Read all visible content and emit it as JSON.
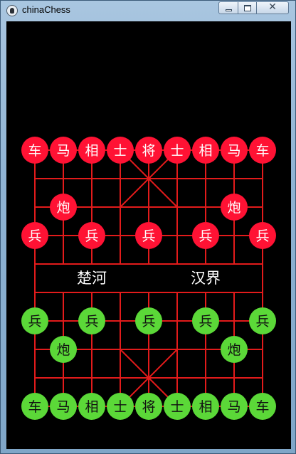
{
  "window": {
    "title": "chinaChess",
    "buttons": {
      "minimize": "",
      "maximize": "",
      "close": "✕"
    }
  },
  "board": {
    "files": 9,
    "ranks": 10,
    "line_color": "#e21b1b",
    "background": "#000000",
    "river": {
      "left_text": "楚河",
      "right_text": "汉界",
      "text_color": "#ffffff"
    }
  },
  "sides": {
    "red": {
      "fill": "#ff1234",
      "text": "#ffffff"
    },
    "green": {
      "fill": "#5bd838",
      "text": "#111111"
    }
  },
  "pieces": [
    {
      "side": "red",
      "label": "车",
      "file": 0,
      "rank": 0
    },
    {
      "side": "red",
      "label": "马",
      "file": 1,
      "rank": 0
    },
    {
      "side": "red",
      "label": "相",
      "file": 2,
      "rank": 0
    },
    {
      "side": "red",
      "label": "士",
      "file": 3,
      "rank": 0
    },
    {
      "side": "red",
      "label": "将",
      "file": 4,
      "rank": 0
    },
    {
      "side": "red",
      "label": "士",
      "file": 5,
      "rank": 0
    },
    {
      "side": "red",
      "label": "相",
      "file": 6,
      "rank": 0
    },
    {
      "side": "red",
      "label": "马",
      "file": 7,
      "rank": 0
    },
    {
      "side": "red",
      "label": "车",
      "file": 8,
      "rank": 0
    },
    {
      "side": "red",
      "label": "炮",
      "file": 1,
      "rank": 2
    },
    {
      "side": "red",
      "label": "炮",
      "file": 7,
      "rank": 2
    },
    {
      "side": "red",
      "label": "兵",
      "file": 0,
      "rank": 3
    },
    {
      "side": "red",
      "label": "兵",
      "file": 2,
      "rank": 3
    },
    {
      "side": "red",
      "label": "兵",
      "file": 4,
      "rank": 3
    },
    {
      "side": "red",
      "label": "兵",
      "file": 6,
      "rank": 3
    },
    {
      "side": "red",
      "label": "兵",
      "file": 8,
      "rank": 3
    },
    {
      "side": "green",
      "label": "兵",
      "file": 0,
      "rank": 6
    },
    {
      "side": "green",
      "label": "兵",
      "file": 2,
      "rank": 6
    },
    {
      "side": "green",
      "label": "兵",
      "file": 4,
      "rank": 6
    },
    {
      "side": "green",
      "label": "兵",
      "file": 6,
      "rank": 6
    },
    {
      "side": "green",
      "label": "兵",
      "file": 8,
      "rank": 6
    },
    {
      "side": "green",
      "label": "炮",
      "file": 1,
      "rank": 7
    },
    {
      "side": "green",
      "label": "炮",
      "file": 7,
      "rank": 7
    },
    {
      "side": "green",
      "label": "车",
      "file": 0,
      "rank": 9
    },
    {
      "side": "green",
      "label": "马",
      "file": 1,
      "rank": 9
    },
    {
      "side": "green",
      "label": "相",
      "file": 2,
      "rank": 9
    },
    {
      "side": "green",
      "label": "士",
      "file": 3,
      "rank": 9
    },
    {
      "side": "green",
      "label": "将",
      "file": 4,
      "rank": 9
    },
    {
      "side": "green",
      "label": "士",
      "file": 5,
      "rank": 9
    },
    {
      "side": "green",
      "label": "相",
      "file": 6,
      "rank": 9
    },
    {
      "side": "green",
      "label": "马",
      "file": 7,
      "rank": 9
    },
    {
      "side": "green",
      "label": "车",
      "file": 8,
      "rank": 9
    }
  ]
}
